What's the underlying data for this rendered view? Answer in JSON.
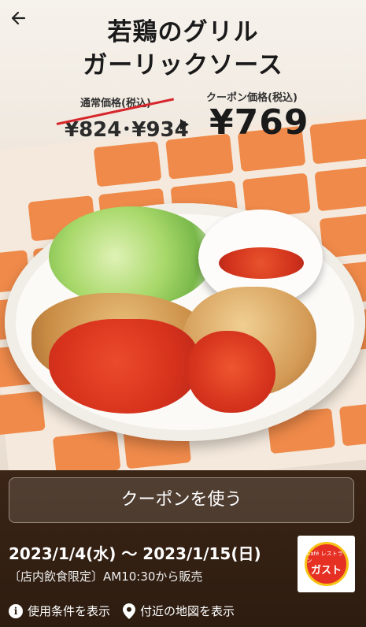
{
  "header": {
    "back_icon": "arrow-left-icon",
    "title_line1": "若鶏のグリル",
    "title_line2": "ガーリックソース"
  },
  "pricing": {
    "regular_label": "通常価格(税込)",
    "regular_price": "¥824･¥934",
    "coupon_label": "クーポン価格(税込)",
    "coupon_price": "¥769"
  },
  "coupon": {
    "use_button_label": "クーポンを使う",
    "period": "2023/1/4(水) 〜 2023/1/15(日)",
    "note": "〔店内飲食限定〕AM10:30から販売"
  },
  "brand": {
    "logo_small_text": "Café レストラン",
    "logo_main_text": "ガスト",
    "colors": {
      "logo_red": "#e53023",
      "logo_yellow": "#f7c316"
    }
  },
  "links": {
    "terms_label": "使用条件を表示",
    "terms_icon": "info-icon",
    "map_label": "付近の地図を表示",
    "map_icon": "map-pin-icon"
  }
}
